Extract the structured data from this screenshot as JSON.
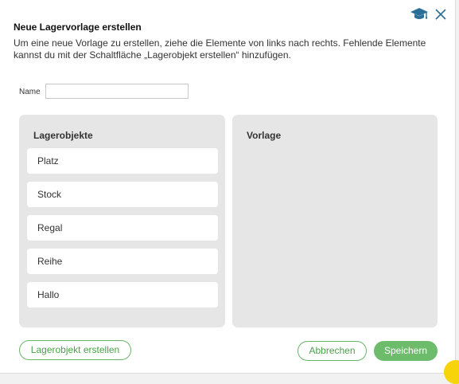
{
  "dialog": {
    "title": "Neue Lagervorlage erstellen",
    "description": "Um eine neue Vorlage zu erstellen, ziehe die Elemente von links nach rechts. Fehlende Elemente kannst du mit der Schaltfläche „Lagerobjekt erstellen“ hinzufügen.",
    "icons": {
      "help": "graduation-cap-icon",
      "close": "close-icon"
    }
  },
  "name_field": {
    "label": "Name",
    "value": "",
    "placeholder": ""
  },
  "left_panel": {
    "title": "Lagerobjekte",
    "items": [
      {
        "label": "Platz"
      },
      {
        "label": "Stock"
      },
      {
        "label": "Regal"
      },
      {
        "label": "Reihe"
      },
      {
        "label": "Hallo"
      }
    ]
  },
  "right_panel": {
    "title": "Vorlage"
  },
  "buttons": {
    "create": "Lagerobjekt erstellen",
    "cancel": "Abbrechen",
    "save": "Speichern"
  },
  "colors": {
    "accent": "#6cbc6c",
    "panel_bg": "#e6e6e6",
    "icon": "#2a6f97"
  }
}
